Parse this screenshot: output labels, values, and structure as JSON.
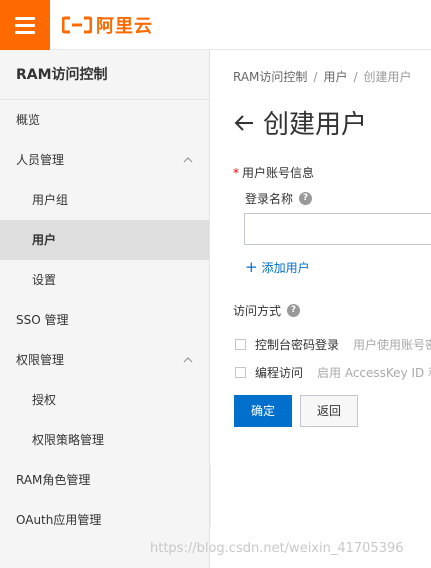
{
  "header": {
    "brand": "阿里云",
    "accent_color": "#ff6a00"
  },
  "sidebar": {
    "title": "RAM访问控制",
    "items": [
      {
        "label": "概览"
      },
      {
        "label": "人员管理"
      },
      {
        "label": "用户组"
      },
      {
        "label": "用户"
      },
      {
        "label": "设置"
      },
      {
        "label": "SSO 管理"
      },
      {
        "label": "权限管理"
      },
      {
        "label": "授权"
      },
      {
        "label": "权限策略管理"
      },
      {
        "label": "RAM角色管理"
      },
      {
        "label": "OAuth应用管理"
      }
    ]
  },
  "breadcrumb": {
    "items": [
      "RAM访问控制",
      "用户",
      "创建用户"
    ],
    "separator": "/"
  },
  "page": {
    "title": "创建用户"
  },
  "form": {
    "account_section": "用户账号信息",
    "login_name_label": "登录名称",
    "login_name_value": "",
    "add_user": "添加用户",
    "access_section": "访问方式",
    "console_login_label": "控制台密码登录",
    "console_login_hint": "用户使用账号密",
    "programmatic_label": "编程访问",
    "programmatic_hint": "启用 AccessKey ID 和",
    "ok_button": "确定",
    "back_button": "返回",
    "primary_color": "#0070cc"
  },
  "watermark": "https://blog.csdn.net/weixin_41705396"
}
